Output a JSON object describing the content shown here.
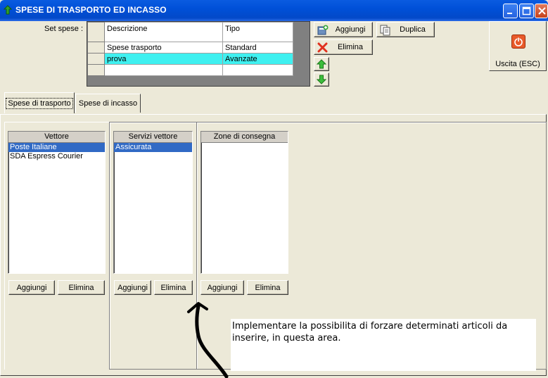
{
  "window": {
    "title": "SPESE DI TRASPORTO ED INCASSO",
    "accent": "#0050D8"
  },
  "set_spese": {
    "label": "Set spese :",
    "columns": [
      "Descrizione",
      "Tipo"
    ],
    "rows": [
      {
        "descrizione": "Spese trasporto",
        "tipo": "Standard"
      },
      {
        "descrizione": "prova",
        "tipo": "Avanzate"
      }
    ],
    "selected_row_color": "#3FF0F0"
  },
  "toolbar": {
    "add_label": "Aggiungi",
    "duplicate_label": "Duplica",
    "delete_label": "Elimina",
    "exit_label": "Uscita (ESC)"
  },
  "tabs": [
    "Spese di trasporto",
    "Spese di incasso"
  ],
  "vettore": {
    "header": "Vettore",
    "items": [
      "Poste Italiane",
      "SDA Espress Courier"
    ],
    "add_label": "Aggiungi",
    "delete_label": "Elimina"
  },
  "servizi": {
    "header": "Servizi vettore",
    "items": [
      "Assicurata"
    ],
    "add_label": "Aggiungi",
    "delete_label": "Elimina"
  },
  "zone": {
    "header": "Zone di consegna",
    "items": [],
    "add_label": "Aggiungi",
    "delete_label": "Elimina"
  },
  "annotation": {
    "text": "Implementare la possibilita di forzare determinati articoli da inserire, in questa area."
  }
}
